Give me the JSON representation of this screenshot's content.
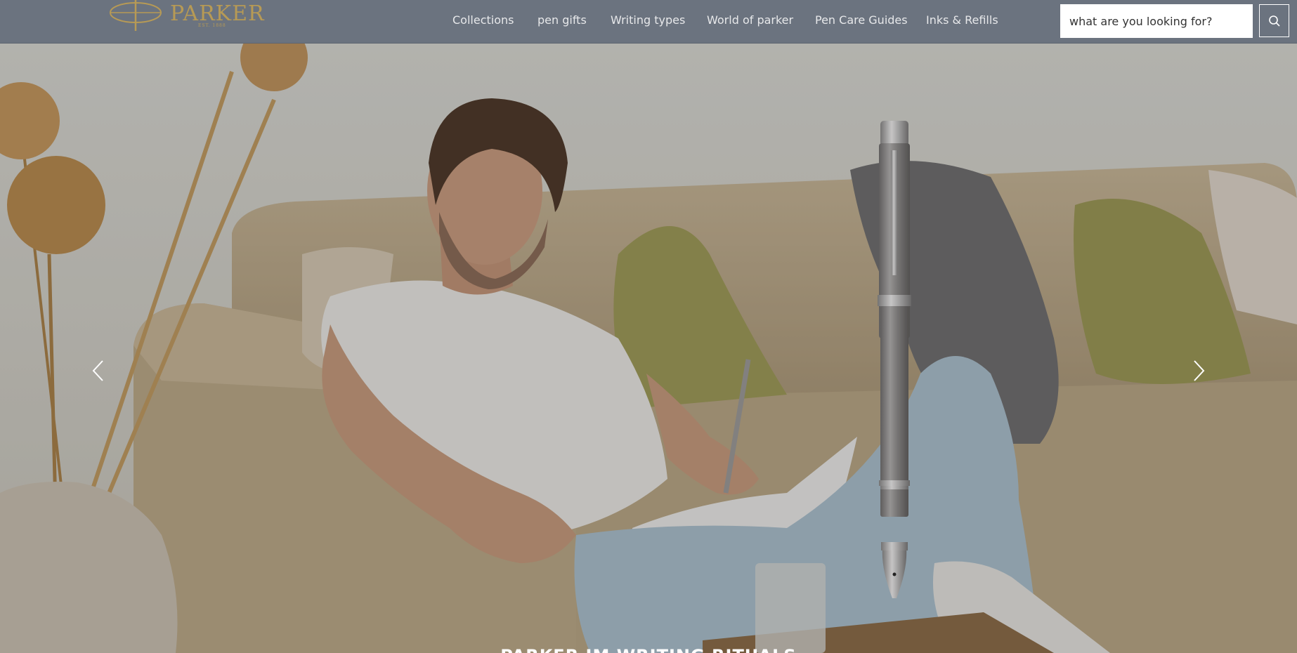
{
  "header": {
    "logo_text": "PARKER",
    "logo_est": "EST. 1888",
    "nav": [
      {
        "label": "Collections"
      },
      {
        "label": "pen gifts"
      },
      {
        "label": "Writing types"
      },
      {
        "label": "World of parker"
      },
      {
        "label": "Pen Care Guides"
      },
      {
        "label": "Inks & Refills"
      }
    ],
    "search": {
      "placeholder": "what are you looking for?",
      "value": ""
    },
    "search_icon": "search-icon"
  },
  "hero": {
    "caption": "PARKER IM WRITING RITUALS",
    "prev_icon": "chevron-left-icon",
    "next_icon": "chevron-right-icon"
  },
  "colors": {
    "header_bg": "#6b737f",
    "brand_gold": "#b79a55",
    "nav_text": "#e7e8ea"
  }
}
